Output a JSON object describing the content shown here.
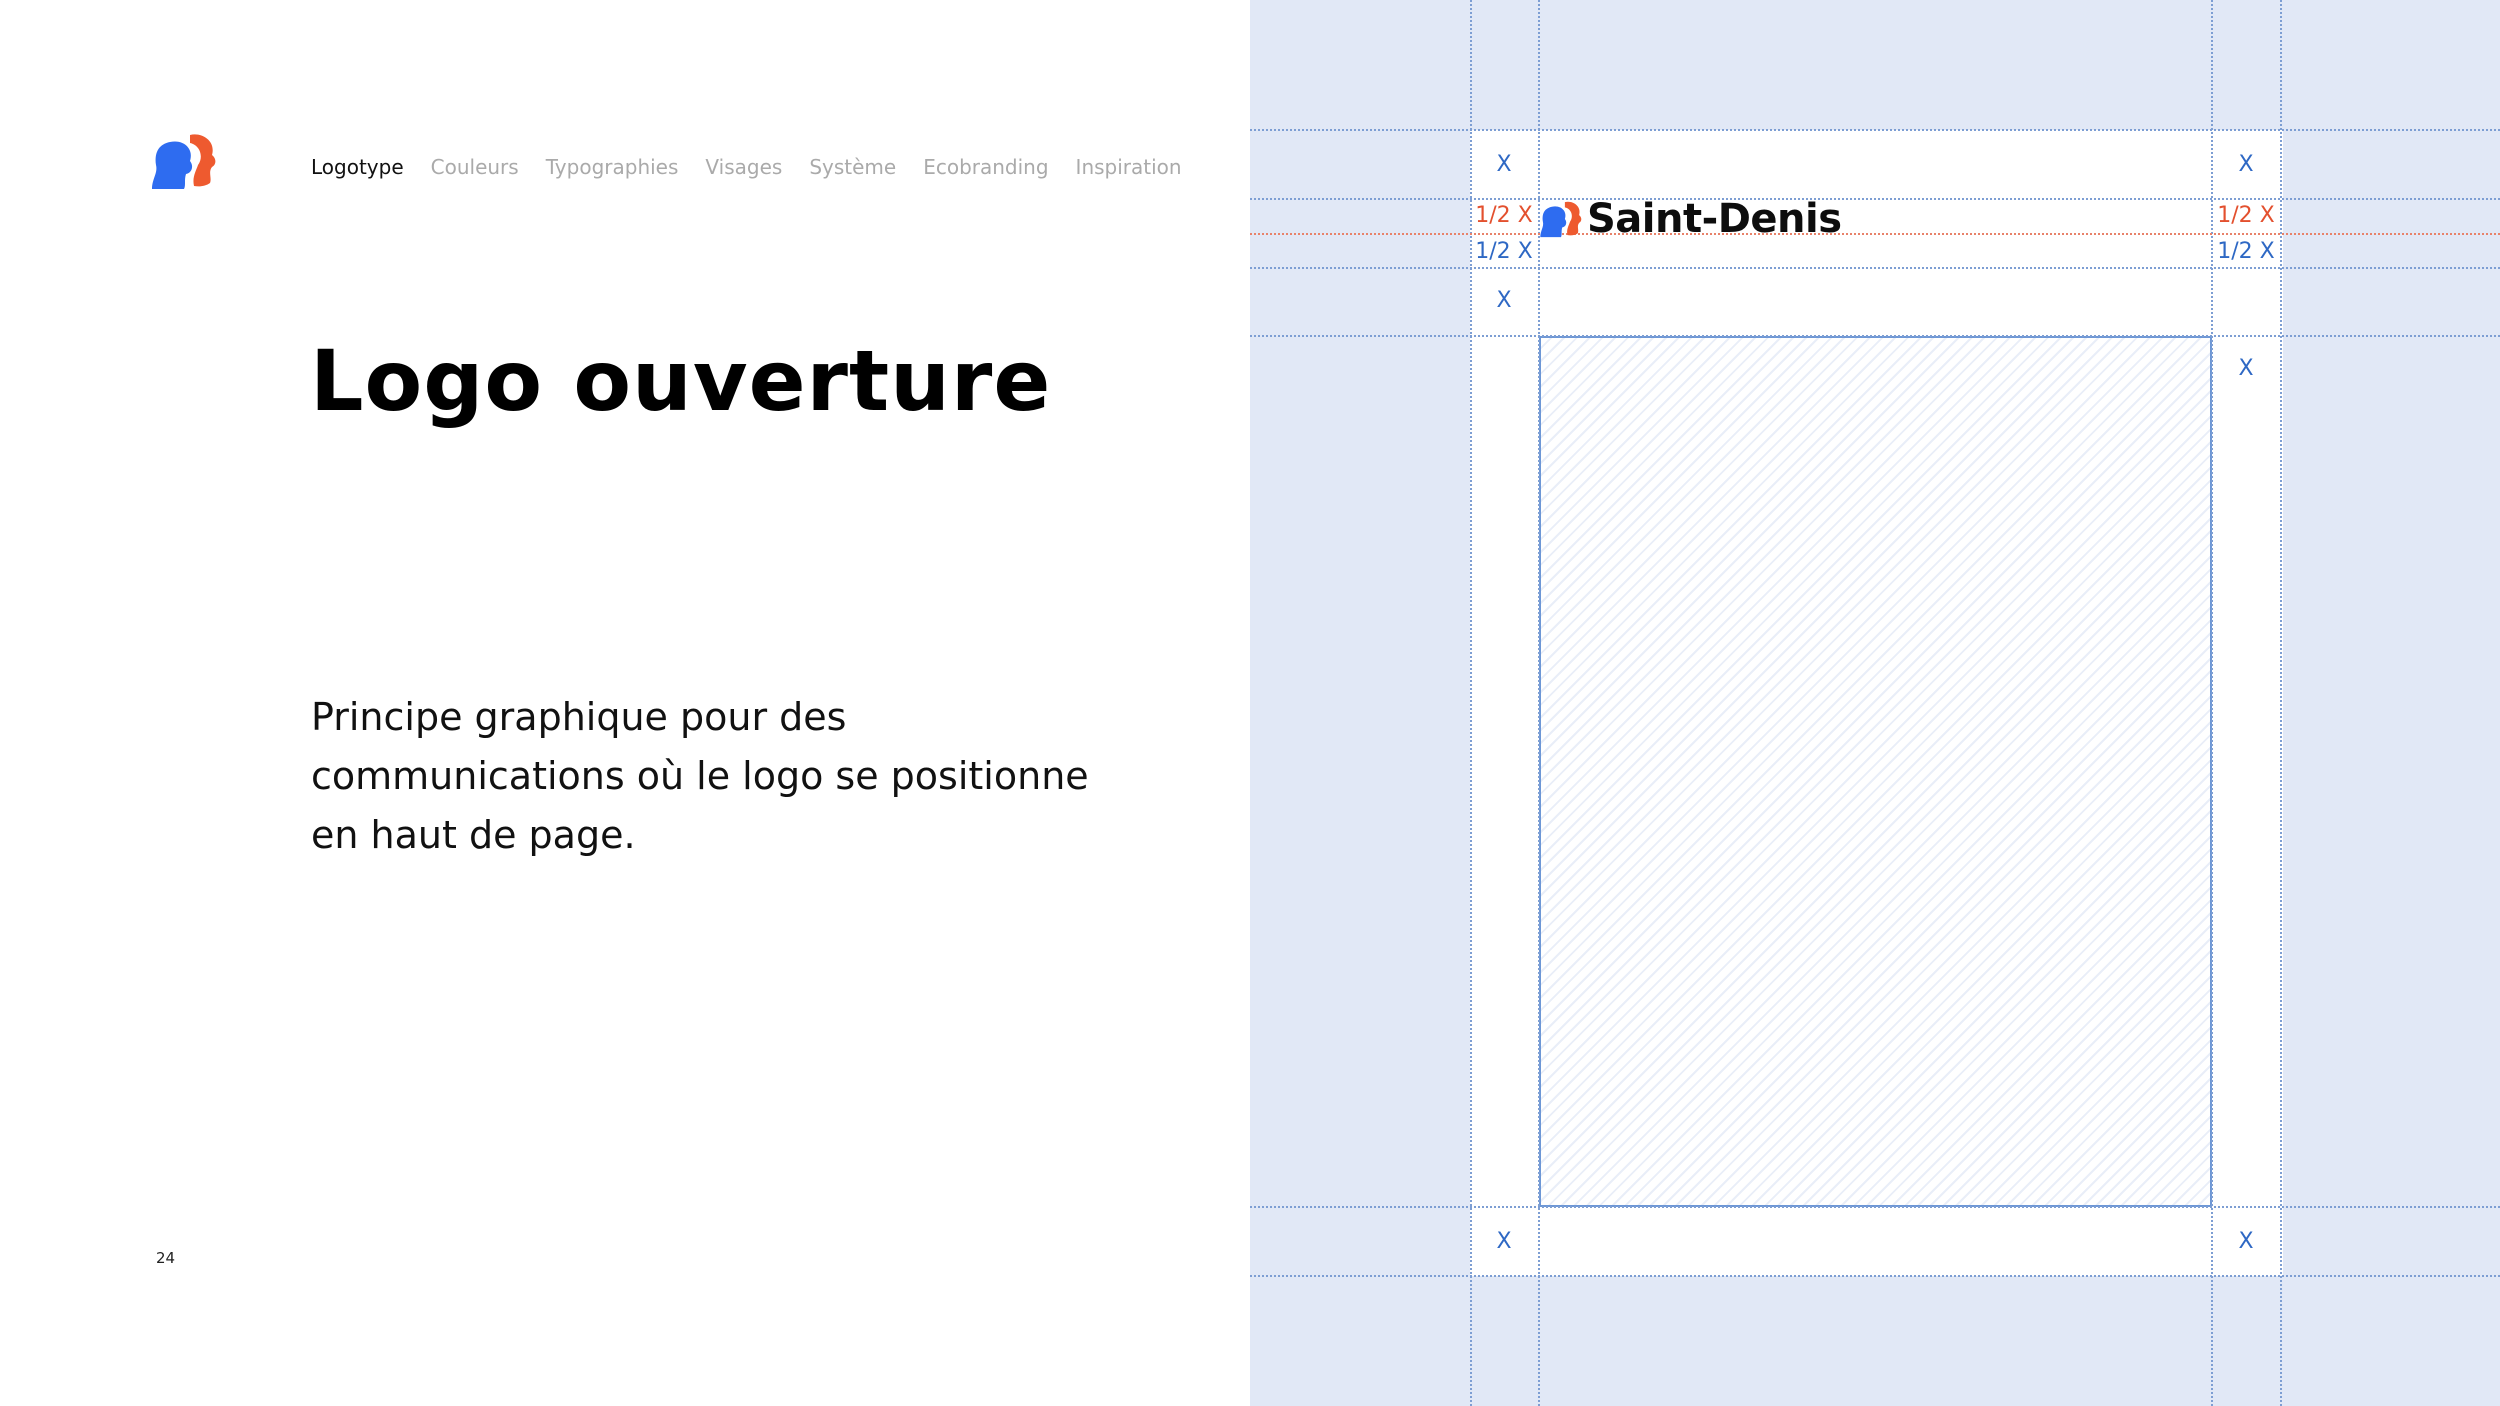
{
  "header": {
    "nav": [
      "Logotype",
      "Couleurs",
      "Typographies",
      "Visages",
      "Système",
      "Ecobranding",
      "Inspiration"
    ],
    "active_index": 0
  },
  "content": {
    "title": "Logo ouverture",
    "description": "Principe graphique pour des communications où le logo se positionne en haut de page.",
    "page_number": "24"
  },
  "diagram": {
    "logo_text": "Saint-Denis",
    "unit_label": "X",
    "half_unit_label": "1/2 X"
  },
  "colors": {
    "brand_blue": "#2e6cf0",
    "brand_orange": "#ee5a2f",
    "grid_blue": "#7d9ed3",
    "panel_bg": "#e1e8f6"
  }
}
